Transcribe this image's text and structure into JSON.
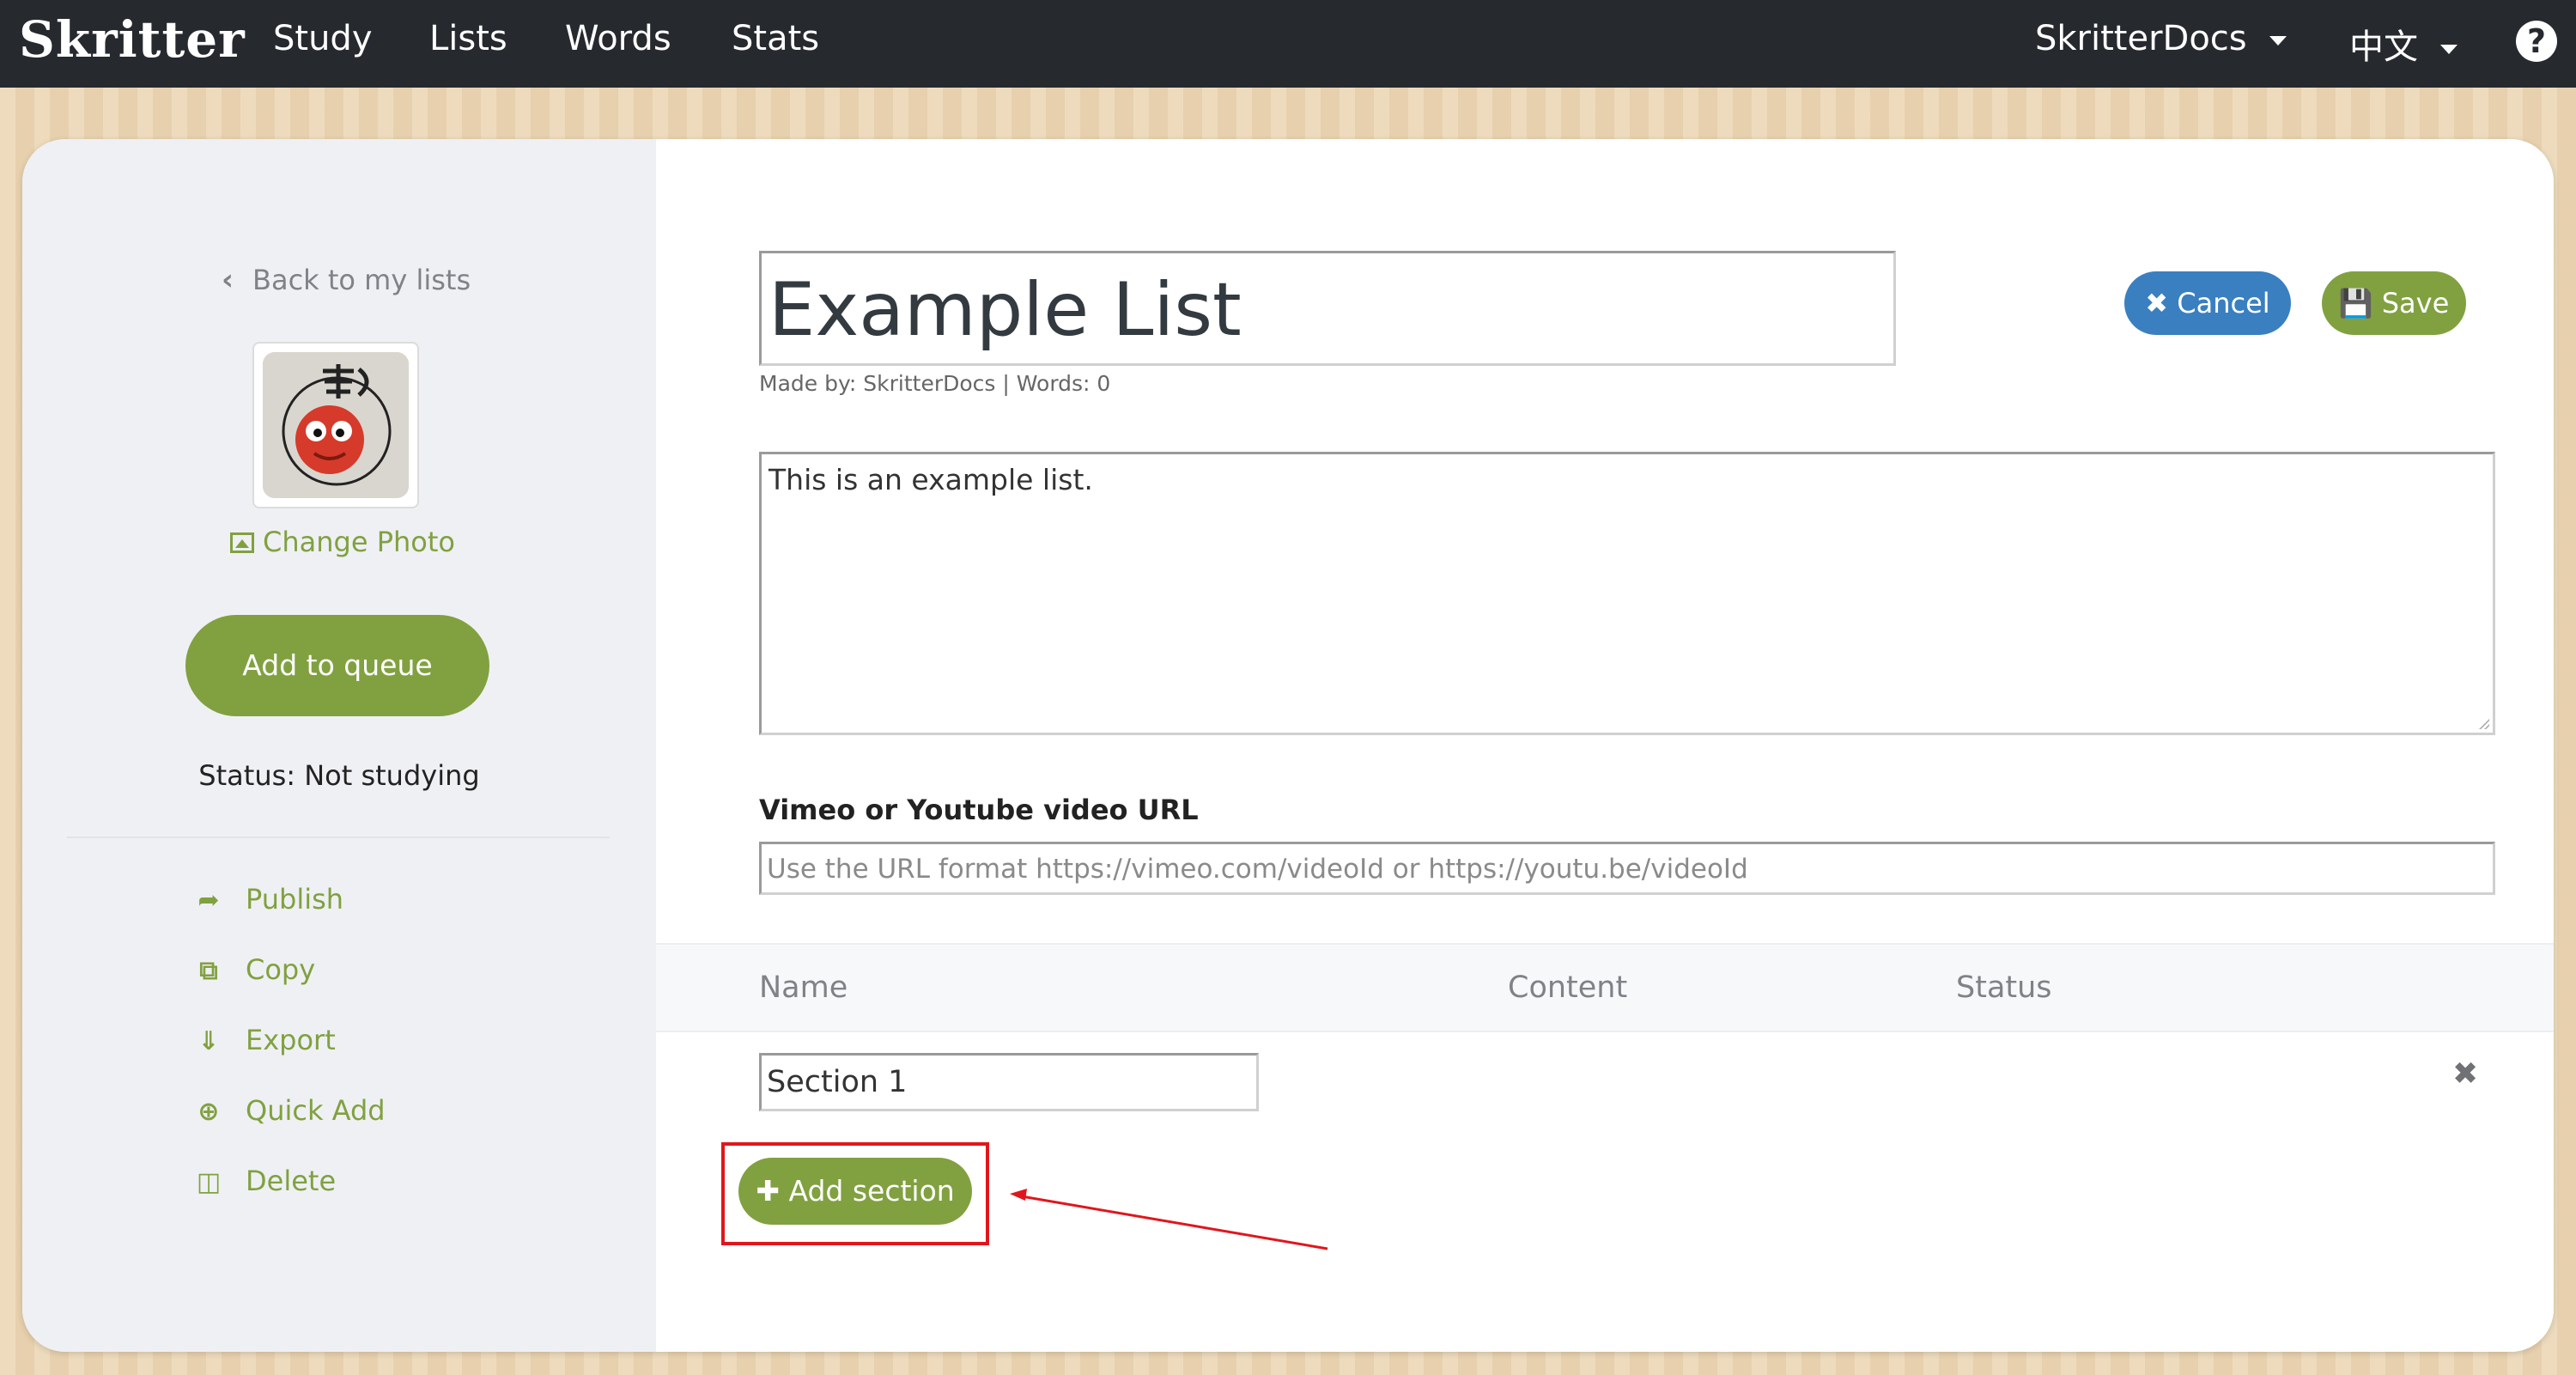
{
  "topnav": {
    "logo": "Skritter",
    "items": [
      "Study",
      "Lists",
      "Words",
      "Stats"
    ],
    "user": "SkritterDocs",
    "language": "中文",
    "help": "?"
  },
  "sidebar": {
    "back_label": "Back to my lists",
    "change_photo": "Change Photo",
    "queue_button": "Add to queue",
    "status": "Status: Not studying",
    "actions": [
      "Publish",
      "Copy",
      "Export",
      "Quick Add",
      "Delete"
    ]
  },
  "main": {
    "title_value": "Example List",
    "meta": "Made by: SkritterDocs | Words: 0",
    "cancel": "Cancel",
    "save": "Save",
    "description_value": "This is an example list.",
    "video_label": "Vimeo or Youtube video URL",
    "video_placeholder": "Use the URL format https://vimeo.com/videoId or https://youtu.be/videoId",
    "table_headers": [
      "Name",
      "Content",
      "Status"
    ],
    "sections": [
      {
        "name": "Section 1"
      }
    ],
    "add_section": "Add section"
  },
  "colors": {
    "nav_bg": "#262a2e",
    "accent_green": "#81a140",
    "cancel_blue": "#3a80c0",
    "annotation_red": "#e0161c"
  },
  "icons": {
    "back": "chevron-left-icon",
    "photo": "picture-icon",
    "publish": "share-icon",
    "copy": "copy-icon",
    "export": "download-icon",
    "quick_add": "plus-circle-icon",
    "delete": "trash-icon",
    "cancel": "close-icon",
    "save": "floppy-icon",
    "remove": "close-icon",
    "add": "plus-icon"
  }
}
